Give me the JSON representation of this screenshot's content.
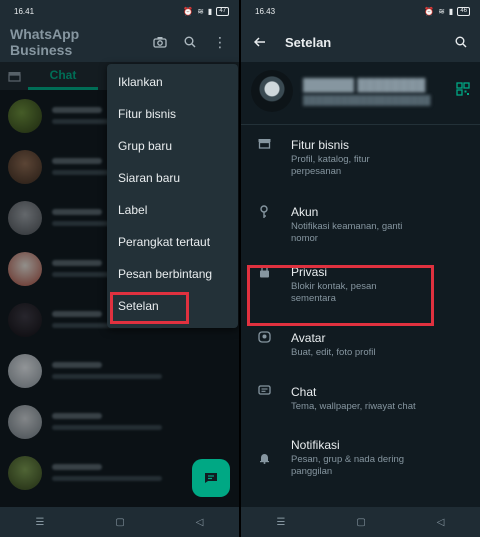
{
  "left": {
    "status_time": "16.41",
    "battery": "47",
    "app_title": "WhatsApp Business",
    "tab_chat": "Chat",
    "menu": [
      "Iklankan",
      "Fitur bisnis",
      "Grup baru",
      "Siaran baru",
      "Label",
      "Perangkat tertaut",
      "Pesan berbintang",
      "Setelan"
    ]
  },
  "right": {
    "status_time": "16.43",
    "battery": "46",
    "title": "Setelan",
    "settings": [
      {
        "title": "Fitur bisnis",
        "sub": "Profil, katalog, fitur perpesanan",
        "icon": "store-icon"
      },
      {
        "title": "Akun",
        "sub": "Notifikasi keamanan, ganti nomor",
        "icon": "key-icon"
      },
      {
        "title": "Privasi",
        "sub": "Blokir kontak, pesan sementara",
        "icon": "lock-icon"
      },
      {
        "title": "Avatar",
        "sub": "Buat, edit, foto profil",
        "icon": "avatar-icon"
      },
      {
        "title": "Chat",
        "sub": "Tema, wallpaper, riwayat chat",
        "icon": "chat-icon"
      },
      {
        "title": "Notifikasi",
        "sub": "Pesan, grup & nada dering panggilan",
        "icon": "bell-icon"
      }
    ]
  },
  "colors": {
    "accent": "#00a884",
    "highlight": "#e0313f",
    "background": "#111b21"
  }
}
